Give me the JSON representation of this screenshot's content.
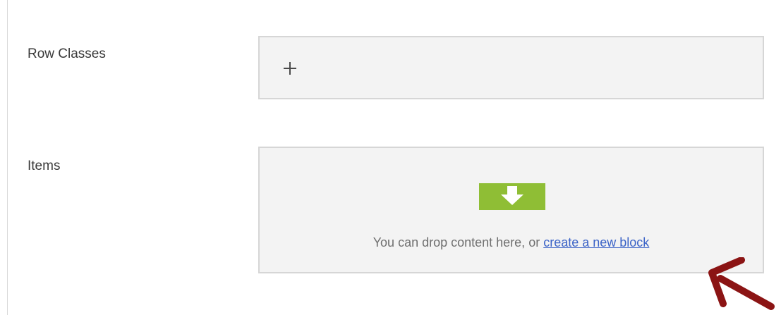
{
  "fields": {
    "row_classes": {
      "label": "Row Classes"
    },
    "items": {
      "label": "Items",
      "drop_text": "You can drop content here, or ",
      "link_text": "create a new block"
    }
  },
  "colors": {
    "drop_icon": "#8fbe35",
    "link": "#3b63c7",
    "annotation_arrow": "#8b1414"
  },
  "icons": {
    "add": "plus-icon",
    "drop": "download-arrow-icon",
    "annotation": "red-arrow-icon"
  }
}
